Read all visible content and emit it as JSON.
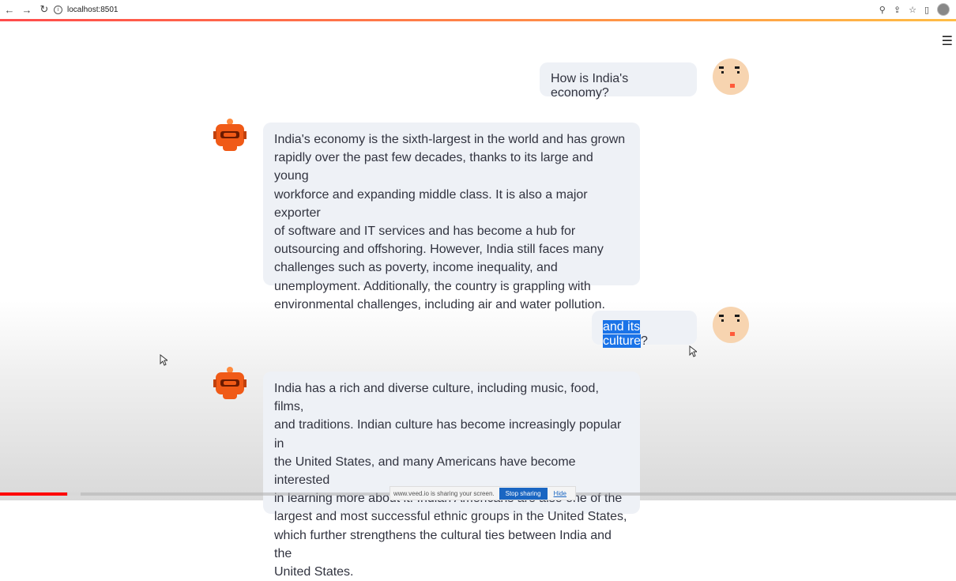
{
  "browser": {
    "url": "localhost:8501",
    "back_icon": "←",
    "forward_icon": "→",
    "reload_icon": "↻",
    "info_icon": "i",
    "zoom_icon": "⚲",
    "share_icon": "⇪",
    "star_icon": "☆",
    "sidepanel_icon": "▯"
  },
  "app": {
    "menu_icon": "☰"
  },
  "chat": {
    "messages": [
      {
        "role": "user",
        "text": "How is India's economy?"
      },
      {
        "role": "bot",
        "lines": [
          "India's economy is the sixth-largest in the world and has grown",
          "rapidly over the past few decades, thanks to its large and young",
          "workforce and expanding middle class. It is also a major exporter",
          "of software and IT services and has become a hub for",
          "outsourcing and offshoring. However, India still faces many",
          "challenges such as poverty, income inequality, and",
          "unemployment. Additionally, the country is grappling with",
          "environmental challenges, including air and water pollution."
        ]
      },
      {
        "role": "user",
        "text_selected": "and its culture",
        "text_rest": "?"
      },
      {
        "role": "bot",
        "lines": [
          "India has a rich and diverse culture, including music, food, films,",
          "and traditions. Indian culture has become increasingly popular in",
          "the United States, and many Americans have become interested",
          "in learning more about it. Indian Americans are also one of the",
          "largest and most successful ethnic groups in the United States,",
          "which further strengthens the cultural ties between India and the",
          "United States."
        ]
      }
    ]
  },
  "video": {
    "progress_percent": 7
  },
  "share_bar": {
    "text": "www.veed.io is sharing your screen.",
    "stop_label": "Stop sharing",
    "hide_label": "Hide"
  },
  "colors": {
    "bubble_bg": "#eef1f6",
    "text": "#31333f",
    "accent_start": "#ff4b4b",
    "accent_end": "#ffbd45",
    "selection": "#1a73e8",
    "bot_orange": "#f05a17",
    "user_avatar_skin": "#f7d4b0"
  }
}
